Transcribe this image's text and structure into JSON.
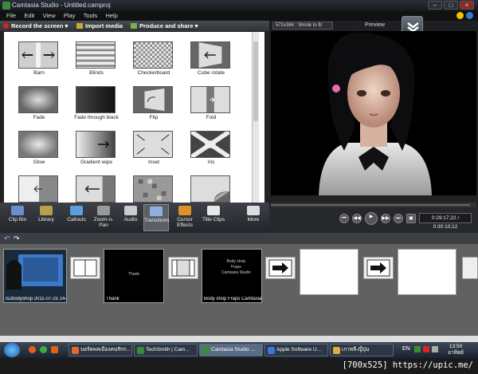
{
  "window": {
    "title": "Camtasia Studio - Untitled.camproj",
    "controls": [
      "–",
      "□",
      "×"
    ]
  },
  "menu": [
    "File",
    "Edit",
    "View",
    "Play",
    "Tools",
    "Help"
  ],
  "toolbar": {
    "record": "Record the screen ▾",
    "import": "Import media",
    "produce": "Produce and share ▾"
  },
  "transitions": [
    {
      "label": "Barn",
      "icon": "barn-icon"
    },
    {
      "label": "Blinds",
      "icon": "blinds-icon"
    },
    {
      "label": "Checkerboard",
      "icon": "checkerboard-icon"
    },
    {
      "label": "Cube rotate",
      "icon": "cube-rotate-icon"
    },
    {
      "label": "Fade",
      "icon": "fade-icon"
    },
    {
      "label": "Fade through black",
      "icon": "fade-black-icon"
    },
    {
      "label": "Flip",
      "icon": "flip-icon"
    },
    {
      "label": "Fold",
      "icon": "fold-icon"
    },
    {
      "label": "Glow",
      "icon": "glow-icon"
    },
    {
      "label": "Gradient wipe",
      "icon": "gradient-wipe-icon"
    },
    {
      "label": "Inset",
      "icon": "inset-icon"
    },
    {
      "label": "Iris",
      "icon": "iris-icon"
    },
    {
      "label": "",
      "icon": "slide-left-icon"
    },
    {
      "label": "",
      "icon": "push-left-icon"
    },
    {
      "label": "",
      "icon": "pixelate-icon"
    },
    {
      "label": "",
      "icon": "page-curl-icon"
    }
  ],
  "clip_tabs": [
    {
      "label": "Clip Bin",
      "color": "#6a8fd0"
    },
    {
      "label": "Library",
      "color": "#b8a04a"
    },
    {
      "label": "Callouts",
      "color": "#5aa0e0"
    },
    {
      "label": "Zoom-n-Pan",
      "color": "#999999"
    },
    {
      "label": "Audio",
      "color": "#cccccc"
    },
    {
      "label": "Transitions",
      "color": "#8fb0e0"
    },
    {
      "label": "Cursor Effects",
      "color": "#e0902a"
    },
    {
      "label": "Title Clips",
      "color": "#e8e8e8"
    },
    {
      "label": "More",
      "color": "#dddddd"
    }
  ],
  "preview": {
    "resolution": "572x384 : Shrink to fit",
    "label": "Preview",
    "time": "0:29:17;22 / 0:30:10;12"
  },
  "timeline": {
    "clips": [
      {
        "caption": "ts2bodyshop 2011-07-25 14-"
      },
      {
        "caption": "Thank",
        "inner": "Thank"
      },
      {
        "caption": "Body shop  Fraps  Camtasia",
        "inner": [
          "Body shop",
          "Fraps",
          "Camtasia Studio"
        ]
      }
    ]
  },
  "taskbar": {
    "tasks": [
      {
        "label": "บอร์ดพลเมืองคนรักก...",
        "color": "#e06a2a"
      },
      {
        "label": "TechSmith | Cam...",
        "color": "#3a8a3a"
      },
      {
        "label": "Camtasia Studio ...",
        "color": "#3a8a3a"
      },
      {
        "label": "Apple Software U...",
        "color": "#3a7ad6"
      },
      {
        "label": "เกาหลี-ญี่ปุ่น",
        "color": "#d8b040"
      }
    ],
    "lang": "EN",
    "clock_time": "13:50",
    "clock_day": "อาทิตย์"
  },
  "watermark": "[700x525] https://upic.me/"
}
